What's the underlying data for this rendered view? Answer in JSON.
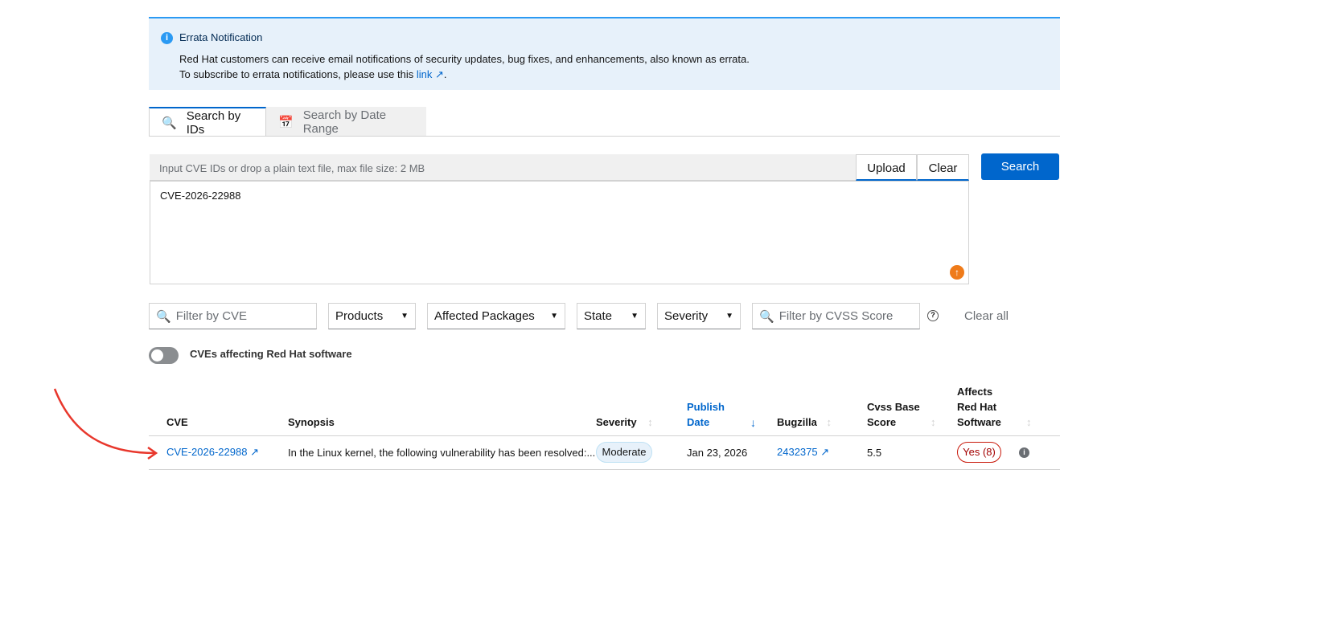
{
  "alert": {
    "title": "Errata Notification",
    "line1": "Red Hat customers can receive email notifications of security updates, bug fixes, and enhancements, also known as errata.",
    "line2_prefix": "To subscribe to errata notifications, please use this ",
    "link": "link",
    "line2_suffix": "."
  },
  "tabs": [
    {
      "label": "Search by IDs",
      "icon": "search-icon",
      "active": true
    },
    {
      "label": "Search by Date Range",
      "icon": "calendar-icon",
      "active": false
    }
  ],
  "input": {
    "placeholder": "Input CVE IDs or drop a plain text file, max file size: 2 MB",
    "upload": "Upload",
    "clear": "Clear",
    "value": "CVE-2026-22988"
  },
  "search_label": "Search",
  "filters": {
    "cve_placeholder": "Filter by CVE",
    "products": "Products",
    "packages": "Affected Packages",
    "state": "State",
    "severity": "Severity",
    "cvss_placeholder": "Filter by CVSS Score",
    "clear_all": "Clear all"
  },
  "toggle_label": "CVEs affecting Red Hat software",
  "table": {
    "headers": {
      "cve": "CVE",
      "synopsis": "Synopsis",
      "severity": "Severity",
      "publish1": "Publish",
      "publish2": "Date",
      "bugzilla": "Bugzilla",
      "cvss1": "Cvss Base",
      "cvss2": "Score",
      "affects1": "Affects",
      "affects2": "Red Hat",
      "affects3": "Software"
    },
    "rows": [
      {
        "cve": "CVE-2026-22988",
        "synopsis": "In the Linux kernel, the following vulnerability has been resolved:...",
        "severity": "Moderate",
        "date": "Jan 23, 2026",
        "bugzilla": "2432375",
        "cvss": "5.5",
        "affects": "Yes (8)"
      }
    ]
  },
  "colors": {
    "accent": "#0066cc",
    "annotation_arrow": "#e8372c"
  }
}
